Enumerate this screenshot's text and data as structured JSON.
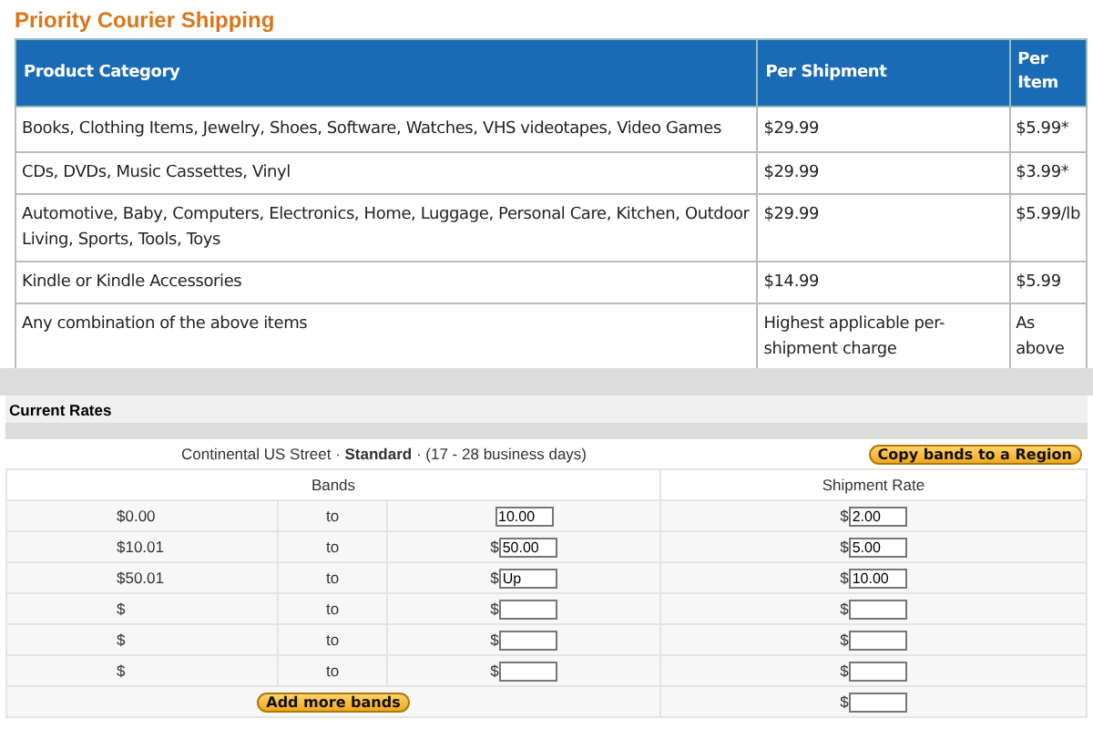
{
  "courier": {
    "title": "Priority Courier Shipping",
    "columns": [
      "Product Category",
      "Per Shipment",
      "Per Item"
    ],
    "rows": [
      {
        "category": "Books, Clothing Items, Jewelry, Shoes, Software, Watches, VHS videotapes, Video Games",
        "per_shipment": "$29.99",
        "per_item": "$5.99*"
      },
      {
        "category": "CDs, DVDs, Music Cassettes, Vinyl",
        "per_shipment": "$29.99",
        "per_item": "$3.99*"
      },
      {
        "category": "Automotive, Baby, Computers, Electronics, Home, Luggage, Personal Care, Kitchen, Outdoor Living, Sports, Tools, Toys",
        "per_shipment": "$29.99",
        "per_item": "$5.99/lb"
      },
      {
        "category": "Kindle or Kindle Accessories",
        "per_shipment": "$14.99",
        "per_item": "$5.99"
      },
      {
        "category": "Any combination of the above items",
        "per_shipment": "Highest applicable per-shipment charge",
        "per_item": "As above"
      }
    ]
  },
  "rates": {
    "heading": "Current Rates",
    "region": {
      "prefix": "Continental US Street · ",
      "method": "Standard",
      "suffix": " · (17 - 28 business days)"
    },
    "copy_button": "Copy bands to a Region",
    "columns": [
      "Bands",
      "Shipment Rate"
    ],
    "bands": [
      {
        "from": "$0.00",
        "to": "to",
        "max": {
          "value": "10.00"
        },
        "rate": {
          "prefix": "$",
          "value": "2.00"
        }
      },
      {
        "from": "$10.01",
        "to": "to",
        "max": {
          "prefix": "$",
          "value": "50.00"
        },
        "rate": {
          "prefix": "$",
          "value": "5.00"
        }
      },
      {
        "from": "$50.01",
        "to": "to",
        "max": {
          "prefix": "$",
          "value": "Up"
        },
        "rate": {
          "prefix": "$",
          "value": "10.00"
        }
      },
      {
        "from": "$",
        "to": "to",
        "max": {
          "prefix": "$"
        },
        "rate": {
          "prefix": "$"
        }
      },
      {
        "from": "$",
        "to": "to",
        "max": {
          "prefix": "$"
        },
        "rate": {
          "prefix": "$"
        }
      },
      {
        "from": "$",
        "to": "to",
        "max": {
          "prefix": "$"
        },
        "rate": {
          "prefix": "$"
        }
      }
    ],
    "add_button": "Add more bands",
    "extra_rate": {
      "prefix": "$"
    }
  }
}
